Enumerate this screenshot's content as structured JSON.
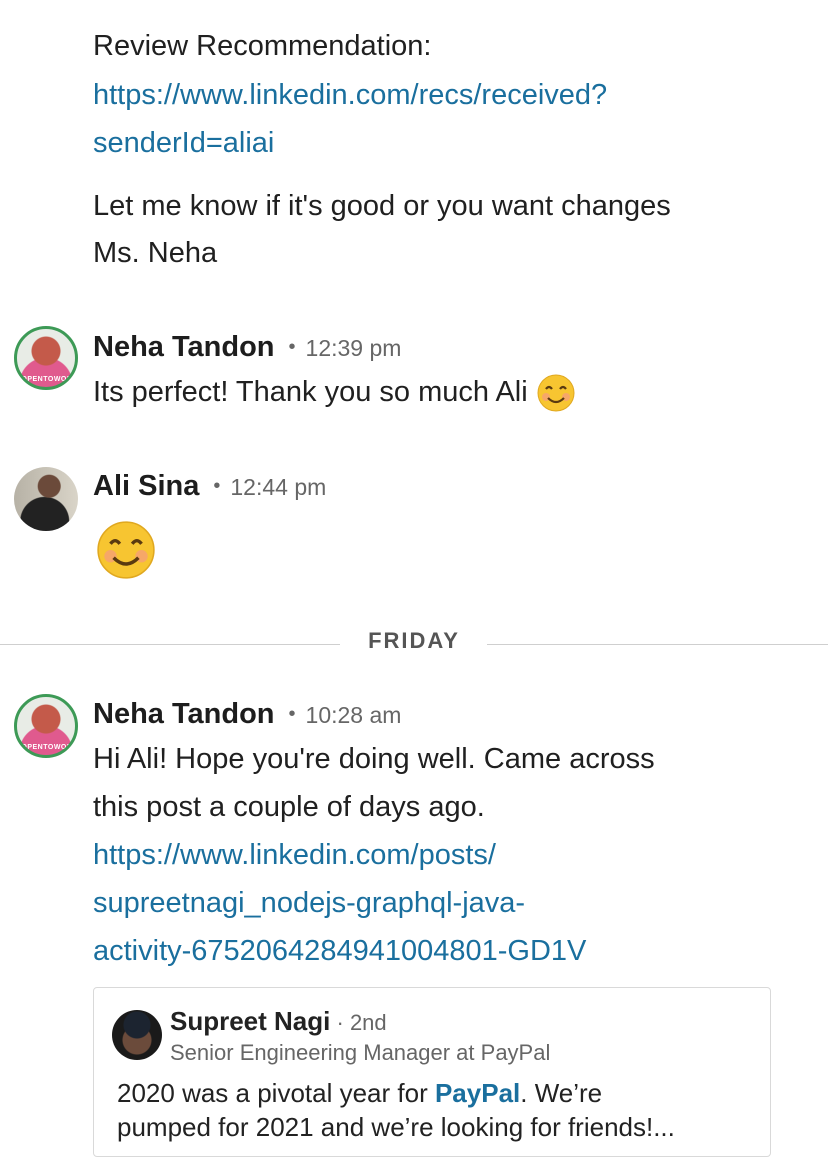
{
  "top": {
    "label": "Review Recommendation:",
    "link_line1": "https://www.linkedin.com/recs/received?",
    "link_line2": "senderId=aliai",
    "text_line1": "Let me know if it's good or you want changes",
    "text_line2": "Ms. Neha"
  },
  "messages": [
    {
      "sender": "Neha Tandon",
      "time": "12:39 pm",
      "text": "Its perfect! Thank you so much Ali"
    },
    {
      "sender": "Ali Sina",
      "time": "12:44 pm"
    }
  ],
  "day_divider": "FRIDAY",
  "friday": {
    "sender": "Neha Tandon",
    "time": "10:28 am",
    "text_line1": "Hi Ali! Hope you're doing well. Came across",
    "text_line2": "this post a couple of days ago.",
    "link_line1": "https://www.linkedin.com/posts/",
    "link_line2": "supreetnagi_nodejs-graphql-java-",
    "link_line3": "activity-6752064284941004801-GD1V"
  },
  "preview_card": {
    "name": "Supreet Nagi",
    "degree": "2nd",
    "title": "Senior Engineering Manager at PayPal",
    "body_prefix": "2020 was a pivotal year for ",
    "body_highlight": "PayPal",
    "body_suffix": ". We’re",
    "body_line2": "pumped for 2021 and we’re looking for friends!..."
  },
  "colors": {
    "link": "#1a6f9e",
    "avatar_ring": "#3d9a56"
  }
}
